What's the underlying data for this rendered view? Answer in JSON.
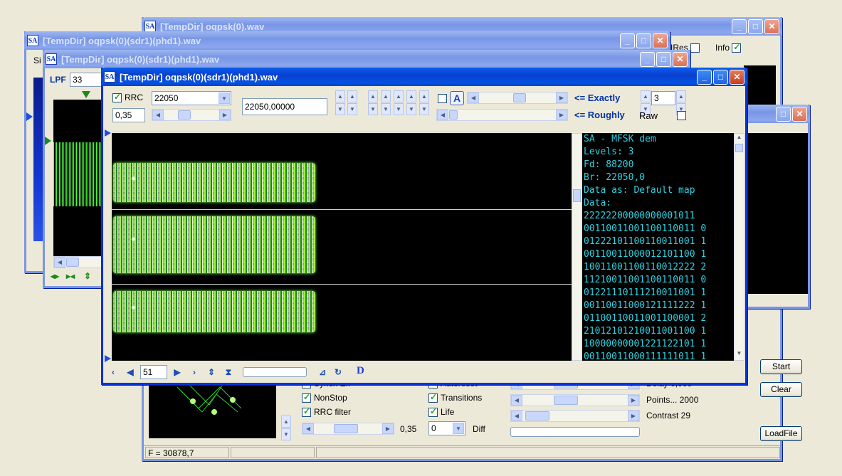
{
  "windows": {
    "back": {
      "title": "[TempDir] oqpsk(0).wav",
      "top_checks": [
        {
          "label": "IRes",
          "checked": false
        },
        {
          "label": "Info",
          "checked": true
        }
      ],
      "checks_left": [
        {
          "label": "Synch Err",
          "checked": false
        },
        {
          "label": "NonStop",
          "checked": true
        },
        {
          "label": "RRC filter",
          "checked": true
        }
      ],
      "checks_mid": [
        {
          "label": "Autoreset",
          "checked": false
        },
        {
          "label": "Transitions",
          "checked": true
        },
        {
          "label": "Life",
          "checked": true
        }
      ],
      "rolloff_value": "0,35",
      "diff_combo": "0",
      "diff_label": "Diff",
      "param_labels": [
        "Delay 0,000",
        "Points... 2000",
        "Contrast 29"
      ],
      "buttons": {
        "start": "Start",
        "clear": "Clear",
        "loadfile": "LoadFile"
      },
      "status": "F = 30878,7"
    },
    "mid1": {
      "title": "[TempDir] oqpsk(0)(sdr1)(phd1).wav",
      "menu_fragment": "Si"
    },
    "mid2": {
      "title": "[TempDir] oqpsk(0)(sdr1)(phd1).wav",
      "lpf_label": "LPF",
      "lpf_value": "33"
    },
    "front": {
      "title": "[TempDir] oqpsk(0)(sdr1)(phd1).wav",
      "rrc_label": "RRC",
      "rrc_checked": true,
      "rrc_value": "0,35",
      "rate_combo": "22050",
      "rate_field": "22050,00000",
      "exactly_label": "<= Exactly",
      "roughly_label": "<= Roughly",
      "levels_value": "3",
      "raw_label": "Raw",
      "raw_checked": false,
      "a_button": "A",
      "page_value": "51",
      "d_button": "D",
      "info_lines": [
        "SA - MFSK dem",
        "Levels: 3",
        "Fd: 88200",
        "Br: 22050,0",
        "Data as: Default map",
        "Data:",
        "22222200000000001011",
        "00110011001100110011 0",
        "01222101100110011001 1",
        "00110011000012101100 1",
        "10011001100110012222 2",
        "11210011001100110011 0",
        "01221110111210011001 1",
        "00110011000121111222 1",
        "01100110011001100001 2",
        "21012101210011001100 1",
        "10000000001221122101 1",
        "00110011000111111011 1"
      ]
    }
  },
  "colors": {
    "title_active": "#0a3fd1",
    "info_text": "#2fd0e0",
    "plot_green": "#7dff3a"
  },
  "icons": [
    "minimize-icon",
    "maximize-icon",
    "close-icon",
    "app-icon"
  ]
}
